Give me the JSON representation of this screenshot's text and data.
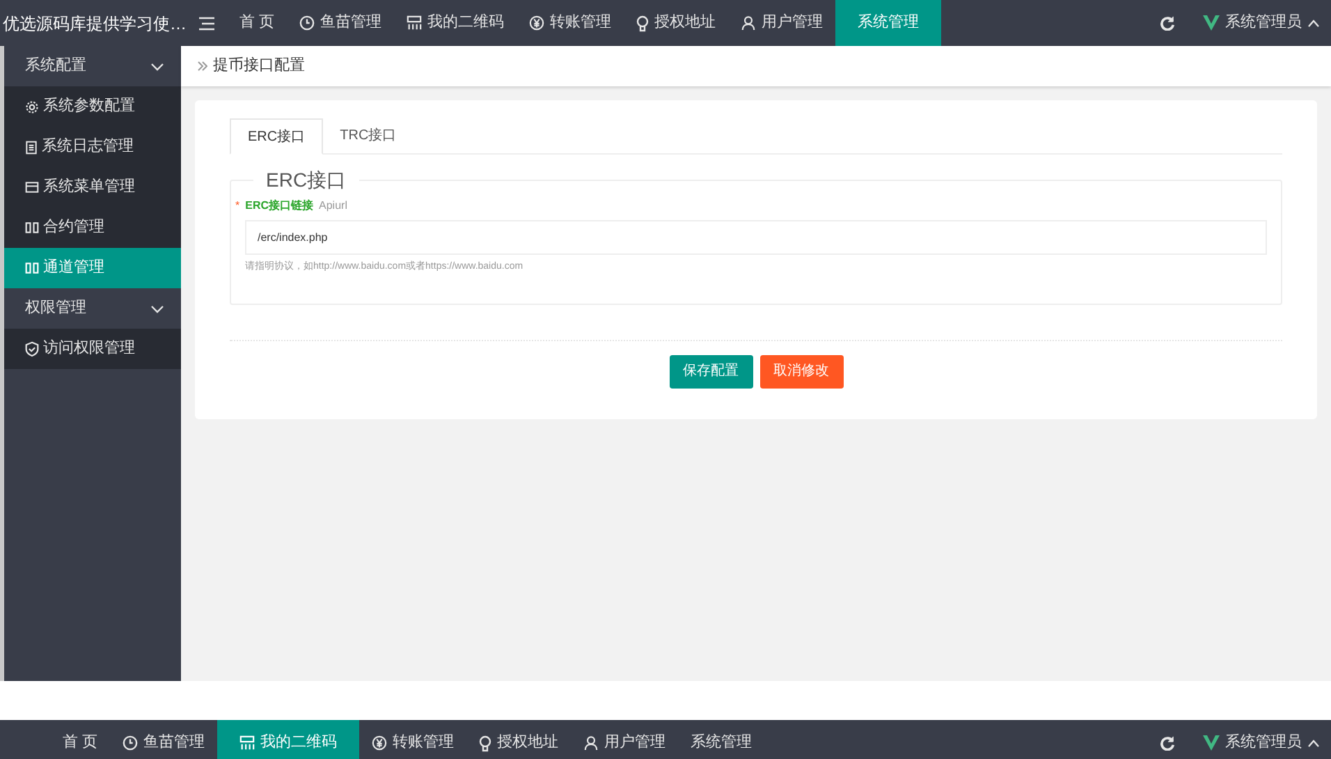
{
  "header": {
    "title": "优选源码库提供学习使…",
    "nav": [
      {
        "label": "首 页",
        "selected": false
      },
      {
        "label": "鱼苗管理",
        "selected": false
      },
      {
        "label": "我的二维码",
        "selected": false
      },
      {
        "label": "转账管理",
        "selected": false
      },
      {
        "label": "授权地址",
        "selected": false
      },
      {
        "label": "用户管理",
        "selected": false
      },
      {
        "label": "系统管理",
        "selected": true
      }
    ],
    "user": "系统管理员"
  },
  "sidebar": {
    "groups": [
      {
        "label": "系统配置",
        "expanded": true,
        "children": [
          {
            "label": "系统参数配置",
            "selected": false
          },
          {
            "label": "系统日志管理",
            "selected": false
          },
          {
            "label": "系统菜单管理",
            "selected": false
          },
          {
            "label": "合约管理",
            "selected": false
          },
          {
            "label": "通道管理",
            "selected": true
          }
        ]
      },
      {
        "label": "权限管理",
        "expanded": true,
        "children": [
          {
            "label": "访问权限管理",
            "selected": false
          }
        ]
      }
    ]
  },
  "breadcrumb": "提币接口配置",
  "tabs": [
    {
      "label": "ERC接口",
      "selected": true
    },
    {
      "label": "TRC接口",
      "selected": false
    }
  ],
  "fieldset": {
    "legend": "ERC接口",
    "field": {
      "required_mark": "*",
      "label": "ERC接口链接",
      "sublabel": "Apiurl",
      "value": "/erc/index.php",
      "hint": "请指明协议，如http://www.baidu.com或者https://www.baidu.com"
    }
  },
  "buttons": [
    {
      "label": "保存配置",
      "kind": "primary"
    },
    {
      "label": "取消修改",
      "kind": "danger"
    }
  ],
  "footer_header": {
    "nav": [
      {
        "label": "首 页",
        "selected": false
      },
      {
        "label": "鱼苗管理",
        "selected": false
      },
      {
        "label": "我的二维码",
        "selected": true
      },
      {
        "label": "转账管理",
        "selected": false
      },
      {
        "label": "授权地址",
        "selected": false
      },
      {
        "label": "用户管理",
        "selected": false
      },
      {
        "label": "系统管理",
        "selected": false
      }
    ],
    "user": "系统管理员"
  }
}
